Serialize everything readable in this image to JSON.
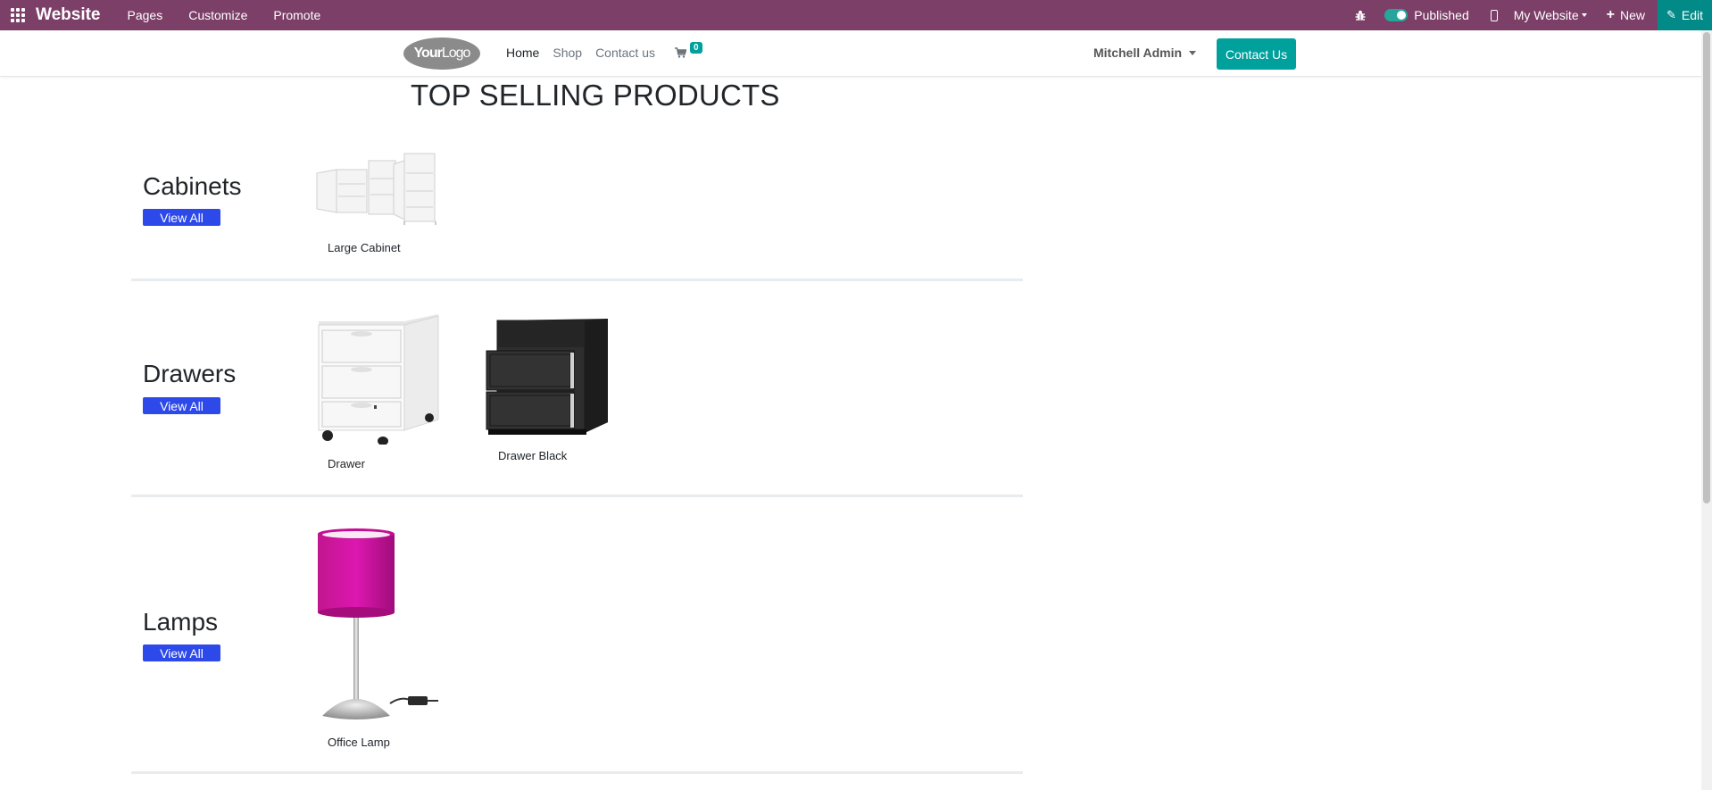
{
  "admin_bar": {
    "brand": "Website",
    "menu": [
      "Pages",
      "Customize",
      "Promote"
    ],
    "published_label": "Published",
    "website_label": "My Website",
    "new_label": "New",
    "edit_label": "Edit",
    "bar_color": "#7c3f68",
    "edit_color": "#018a87"
  },
  "header": {
    "logo": {
      "main": "Your",
      "light": "Logo"
    },
    "nav": [
      "Home",
      "Shop",
      "Contact us"
    ],
    "cart_count": "0",
    "user": "Mitchell Admin",
    "contact_button": "Contact Us",
    "accent_color": "#00a09d"
  },
  "main": {
    "title": "TOP SELLING PRODUCTS",
    "view_all_label": "View All",
    "categories": [
      {
        "name": "Cabinets",
        "products": [
          "Large Cabinet"
        ]
      },
      {
        "name": "Drawers",
        "products": [
          "Drawer",
          "Drawer Black"
        ]
      },
      {
        "name": "Lamps",
        "products": [
          "Office Lamp"
        ]
      }
    ],
    "button_color": "#2d49ea"
  },
  "icons": [
    "apps-grid-icon",
    "bug-icon",
    "mobile-icon",
    "plus-icon",
    "pencil-icon",
    "cart-icon",
    "caret-down-icon"
  ]
}
